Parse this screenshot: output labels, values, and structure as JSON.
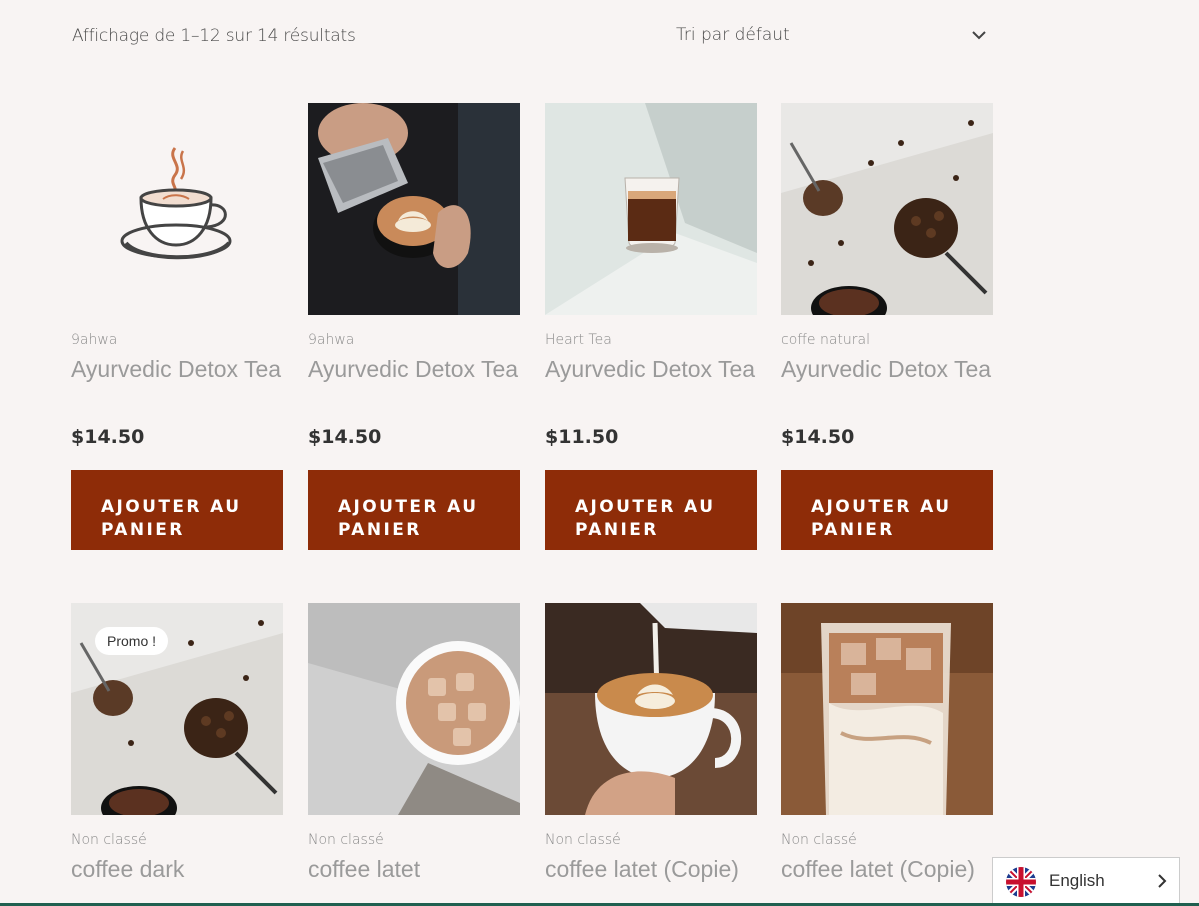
{
  "toolbar": {
    "result_count": "Affichage de 1–12 sur 14 résultats",
    "sort_label": "Tri par défaut",
    "sort_icon": "chevron-down-icon"
  },
  "products": [
    {
      "category": "9ahwa",
      "title": "Ayurvedic Detox Tea",
      "price": "$14.50",
      "button": "AJOUTER AU PANIER",
      "image": "coffee-cup-logo"
    },
    {
      "category": "9ahwa",
      "title": "Ayurvedic Detox Tea",
      "price": "$14.50",
      "button": "AJOUTER AU PANIER",
      "image": "latte-art-pour"
    },
    {
      "category": "Heart Tea",
      "title": "Ayurvedic Detox Tea",
      "price": "$11.50",
      "button": "AJOUTER AU PANIER",
      "image": "espresso-glass-shadow"
    },
    {
      "category": "coffe natural",
      "title": "Ayurvedic Detox Tea",
      "price": "$14.50",
      "button": "AJOUTER AU PANIER",
      "image": "coffee-beans-scoop"
    },
    {
      "category": "Non classé",
      "title": "coffee dark",
      "price": "",
      "badge": "Promo !",
      "image": "coffee-beans-scoop"
    },
    {
      "category": "Non classé",
      "title": "coffee latet",
      "price": "",
      "image": "iced-coffee-cup"
    },
    {
      "category": "Non classé",
      "title": "coffee latet (Copie)",
      "price": "",
      "image": "latte-pour-cup"
    },
    {
      "category": "Non classé",
      "title": "coffee latet (Copie)",
      "price": "",
      "image": "iced-latte-glass"
    }
  ],
  "language": {
    "label": "English",
    "flag_icon": "uk-flag-icon",
    "chevron_icon": "chevron-right-icon"
  },
  "colors": {
    "background": "#f8f4f3",
    "button": "#8e2c08",
    "accent_line": "#1f5f4f"
  }
}
